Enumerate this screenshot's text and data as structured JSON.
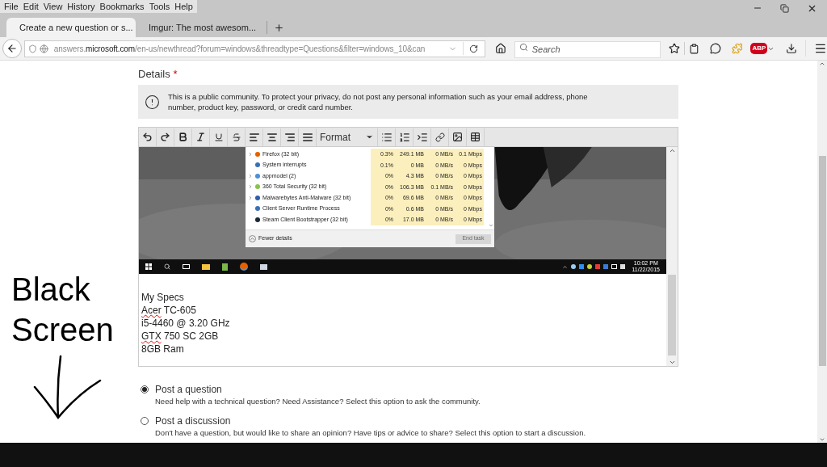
{
  "menu": [
    "File",
    "Edit",
    "View",
    "History",
    "Bookmarks",
    "Tools",
    "Help"
  ],
  "tabs": [
    {
      "title": "Create a new question or s...",
      "selected": true
    },
    {
      "title": "Imgur: The most awesom...",
      "selected": false
    }
  ],
  "address": {
    "prefix": "answers.",
    "domain": "microsoft.com",
    "path": "/en-us/newthread?forum=windows&threadtype=Questions&filter=windows_10&can"
  },
  "search": {
    "placeholder": "Search"
  },
  "abp_label": "ABP",
  "annotation": [
    "Black",
    "Screen"
  ],
  "details": {
    "label": "Details",
    "required_mark": "*"
  },
  "notice": "This is a public community. To protect your privacy, do not post any personal information such as your email address, phone number, product key, password, or credit card number.",
  "format_label": "Format",
  "task_manager": {
    "rows": [
      {
        "name": "Firefox (32 bit)",
        "expandable": true,
        "cpu": "0.3%",
        "memory": "249.1 MB",
        "disk": "0 MB/s",
        "network": "0.1 Mbps"
      },
      {
        "name": "System interrupts",
        "expandable": false,
        "cpu": "0.1%",
        "memory": "0 MB",
        "disk": "0 MB/s",
        "network": "0 Mbps"
      },
      {
        "name": "appmodel (2)",
        "expandable": true,
        "cpu": "0%",
        "memory": "4.3 MB",
        "disk": "0 MB/s",
        "network": "0 Mbps"
      },
      {
        "name": "360 Total Security (32 bit)",
        "expandable": true,
        "cpu": "0%",
        "memory": "106.3 MB",
        "disk": "0.1 MB/s",
        "network": "0 Mbps"
      },
      {
        "name": "Malwarebytes Anti-Malware (32 bit)",
        "expandable": true,
        "cpu": "0%",
        "memory": "69.6 MB",
        "disk": "0 MB/s",
        "network": "0 Mbps"
      },
      {
        "name": "Client Server Runtime Process",
        "expandable": false,
        "cpu": "0%",
        "memory": "0.6 MB",
        "disk": "0 MB/s",
        "network": "0 Mbps"
      },
      {
        "name": "Steam Client Bootstrapper (32 bit)",
        "expandable": false,
        "cpu": "0%",
        "memory": "17.0 MB",
        "disk": "0 MB/s",
        "network": "0 Mbps"
      }
    ],
    "fewer_details": "Fewer details",
    "end_task": {
      "label": "End task",
      "disabled": true
    }
  },
  "clock": {
    "time": "10:02 PM",
    "date": "11/22/2015"
  },
  "body_lines": [
    [
      {
        "text": "My Specs",
        "misspelled": false
      }
    ],
    [
      {
        "text": "Acer",
        "misspelled": true
      },
      {
        "text": " TC-605",
        "misspelled": false
      }
    ],
    [
      {
        "text": "i5-4460 @ 3.20 GHz",
        "misspelled": false
      }
    ],
    [
      {
        "text": "GTX",
        "misspelled": true
      },
      {
        "text": " 750 SC 2GB",
        "misspelled": false
      }
    ],
    [
      {
        "text": "8GB Ram",
        "misspelled": false
      }
    ]
  ],
  "options": [
    {
      "label": "Post a question",
      "description": "Need help with a technical question? Need Assistance? Select this option to ask the community.",
      "selected": true
    },
    {
      "label": "Post a discussion",
      "description": "Don't have a question, but would like to share an opinion? Have tips or advice to share? Select this option to start a discussion.",
      "selected": false
    }
  ]
}
